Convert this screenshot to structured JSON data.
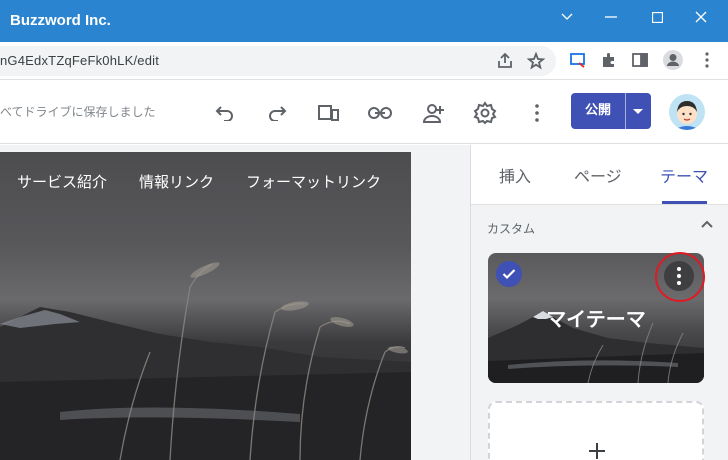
{
  "window": {
    "title": "Buzzword Inc."
  },
  "addressbar": {
    "url": "nG4EdxTZqFeFk0hLK/edit"
  },
  "toolbar": {
    "save_status": "べてドライブに保存しました",
    "icons": [
      "undo-icon",
      "redo-icon",
      "preview-icon",
      "link-icon",
      "add-person-icon",
      "settings-icon",
      "more-vert-icon"
    ],
    "publish_label": "公開"
  },
  "site": {
    "nav": [
      "サービス紹介",
      "情報リンク",
      "フォーマットリンク"
    ]
  },
  "panel": {
    "tabs": [
      {
        "label": "挿入",
        "active": false
      },
      {
        "label": "ページ",
        "active": false
      },
      {
        "label": "テーマ",
        "active": true
      }
    ],
    "section_label": "カスタム",
    "theme_name": "マイテーマ",
    "add_symbol": "+"
  },
  "colors": {
    "titlebar": "#2b84d0",
    "accent": "#3f51b5",
    "highlight_ring": "#e01a22"
  }
}
